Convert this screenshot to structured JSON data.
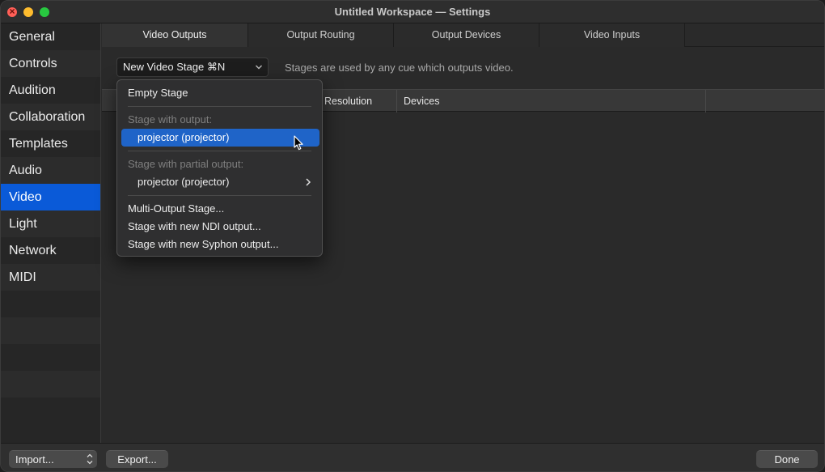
{
  "window": {
    "title": "Untitled Workspace — Settings"
  },
  "sidebar": {
    "items": [
      {
        "label": "General"
      },
      {
        "label": "Controls"
      },
      {
        "label": "Audition"
      },
      {
        "label": "Collaboration"
      },
      {
        "label": "Templates"
      },
      {
        "label": "Audio"
      },
      {
        "label": "Video",
        "selected": true
      },
      {
        "label": "Light"
      },
      {
        "label": "Network"
      },
      {
        "label": "MIDI"
      }
    ]
  },
  "tabs": [
    {
      "label": "Video Outputs",
      "active": true
    },
    {
      "label": "Output Routing"
    },
    {
      "label": "Output Devices"
    },
    {
      "label": "Video Inputs"
    }
  ],
  "toolbar": {
    "dropdown_label": "New Video Stage ⌘N",
    "hint": "Stages are used by any cue which outputs video."
  },
  "table": {
    "columns": [
      "Resolution",
      "Devices"
    ]
  },
  "menu": {
    "empty_stage": "Empty Stage",
    "section_output": "Stage with output:",
    "output_item": "projector (projector)",
    "section_partial": "Stage with partial output:",
    "partial_item": "projector (projector)",
    "multi_output": "Multi-Output Stage...",
    "ndi_output": "Stage with new NDI output...",
    "syphon_output": "Stage with new Syphon output..."
  },
  "bottombar": {
    "import_label": "Import...",
    "export_label": "Export...",
    "done_label": "Done"
  },
  "colors": {
    "accent": "#0a5ad8",
    "menu_highlight": "#1f64c8"
  }
}
